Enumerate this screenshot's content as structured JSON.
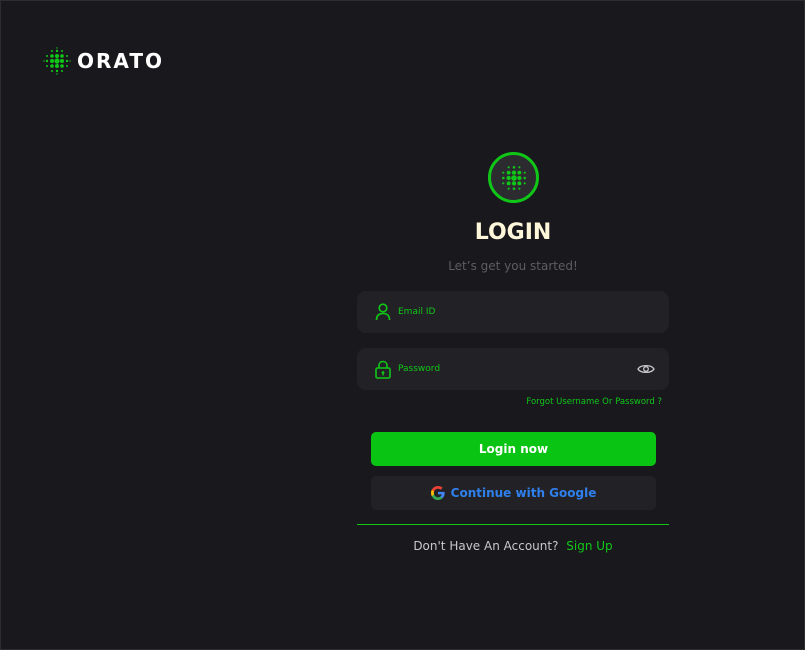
{
  "brand": {
    "name": "ORATO",
    "icon": "dots-logo-icon"
  },
  "login": {
    "title": "LOGIN",
    "subtitle": "Let’s get you started!",
    "email_placeholder": "Email ID",
    "password_placeholder": "Password",
    "forgot_label": "Forgot Username Or Password ?",
    "login_button": "Login now",
    "google_button": "Continue with Google",
    "no_account_text": "Don't Have An Account?",
    "signup_link": "Sign Up"
  },
  "colors": {
    "background": "#19191d",
    "accent": "#10c718",
    "field_bg": "#222226",
    "title": "#fff7d9",
    "google_text": "#2f80ed"
  }
}
